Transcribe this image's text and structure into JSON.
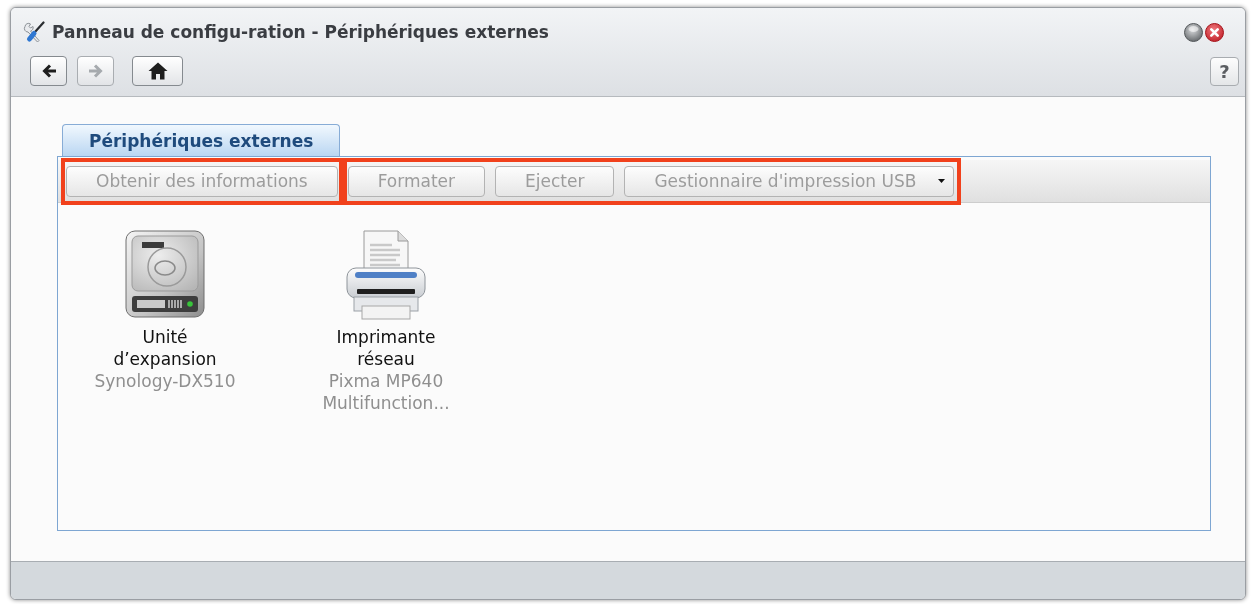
{
  "window": {
    "title": "Panneau de configu-ration - Périphériques externes",
    "help": "?"
  },
  "nav": [
    {
      "kind": "back",
      "disabled": false
    },
    {
      "kind": "forward",
      "disabled": true
    },
    {
      "kind": "home",
      "disabled": false
    }
  ],
  "tabs": [
    {
      "label": "Périphériques externes",
      "selected": true
    }
  ],
  "toolbar": {
    "groups": [
      {
        "highlighted": true,
        "buttons": [
          {
            "kind": "button",
            "label": "Obtenir des informations",
            "disabled": true
          }
        ]
      },
      {
        "highlighted": true,
        "buttons": [
          {
            "kind": "button",
            "label": "Formater",
            "disabled": true
          },
          {
            "kind": "button",
            "label": "Ejecter",
            "disabled": true
          },
          {
            "kind": "dropdown",
            "label": "Gestionnaire d'impression USB",
            "disabled": true
          }
        ]
      }
    ]
  },
  "devices": [
    {
      "kind": "drive",
      "name": "Unité d’expansion",
      "model": "Synology-DX510",
      "selected": false
    },
    {
      "kind": "printer",
      "name": "Imprimante réseau",
      "model": "Pixma MP640 Multifunction...",
      "selected": false
    }
  ]
}
